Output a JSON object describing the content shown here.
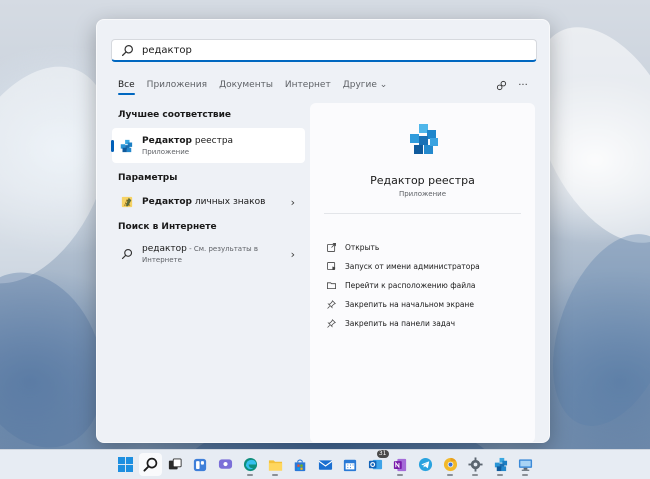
{
  "search": {
    "query": "редактор"
  },
  "tabs": [
    {
      "label": "Все",
      "active": true
    },
    {
      "label": "Приложения"
    },
    {
      "label": "Документы"
    },
    {
      "label": "Интернет"
    },
    {
      "label": "Другие ⌄"
    }
  ],
  "toolbar": {
    "more_label": "···"
  },
  "best_match": {
    "section_title": "Лучшее соответствие",
    "title_bold": "Редактор",
    "title_rest": " реестра",
    "subtitle": "Приложение",
    "icon": "registry-editor-icon"
  },
  "settings": {
    "section_title": "Параметры",
    "item": {
      "title_bold": "Редактор",
      "title_rest": " личных знаков",
      "icon": "private-character-editor-icon"
    }
  },
  "web": {
    "section_title": "Поиск в Интернете",
    "item": {
      "title_bold": "редактор",
      "title_rest": " - См. результаты в",
      "title_line2": "Интернете",
      "icon": "search-icon"
    }
  },
  "preview": {
    "name": "Редактор реестра",
    "type": "Приложение",
    "actions": [
      {
        "label": "Открыть",
        "icon": "open-external-icon"
      },
      {
        "label": "Запуск от имени администратора",
        "icon": "run-as-admin-icon"
      },
      {
        "label": "Перейти к расположению файла",
        "icon": "folder-icon"
      },
      {
        "label": "Закрепить на начальном экране",
        "icon": "pin-icon"
      },
      {
        "label": "Закрепить на панели задач",
        "icon": "pin-icon"
      }
    ]
  },
  "taskbar": {
    "items": [
      "start",
      "search",
      "task-view",
      "widgets",
      "chat",
      "edge",
      "file-explorer",
      "store",
      "mail",
      "calendar",
      "outlook",
      "onenote",
      "telegram",
      "chrome-canary",
      "settings",
      "registry-editor",
      "remote-desktop"
    ],
    "outlook_badge": "31"
  },
  "colors": {
    "accent": "#0067c0",
    "panel": "#eef1f6",
    "preview": "#fbfbfd"
  }
}
